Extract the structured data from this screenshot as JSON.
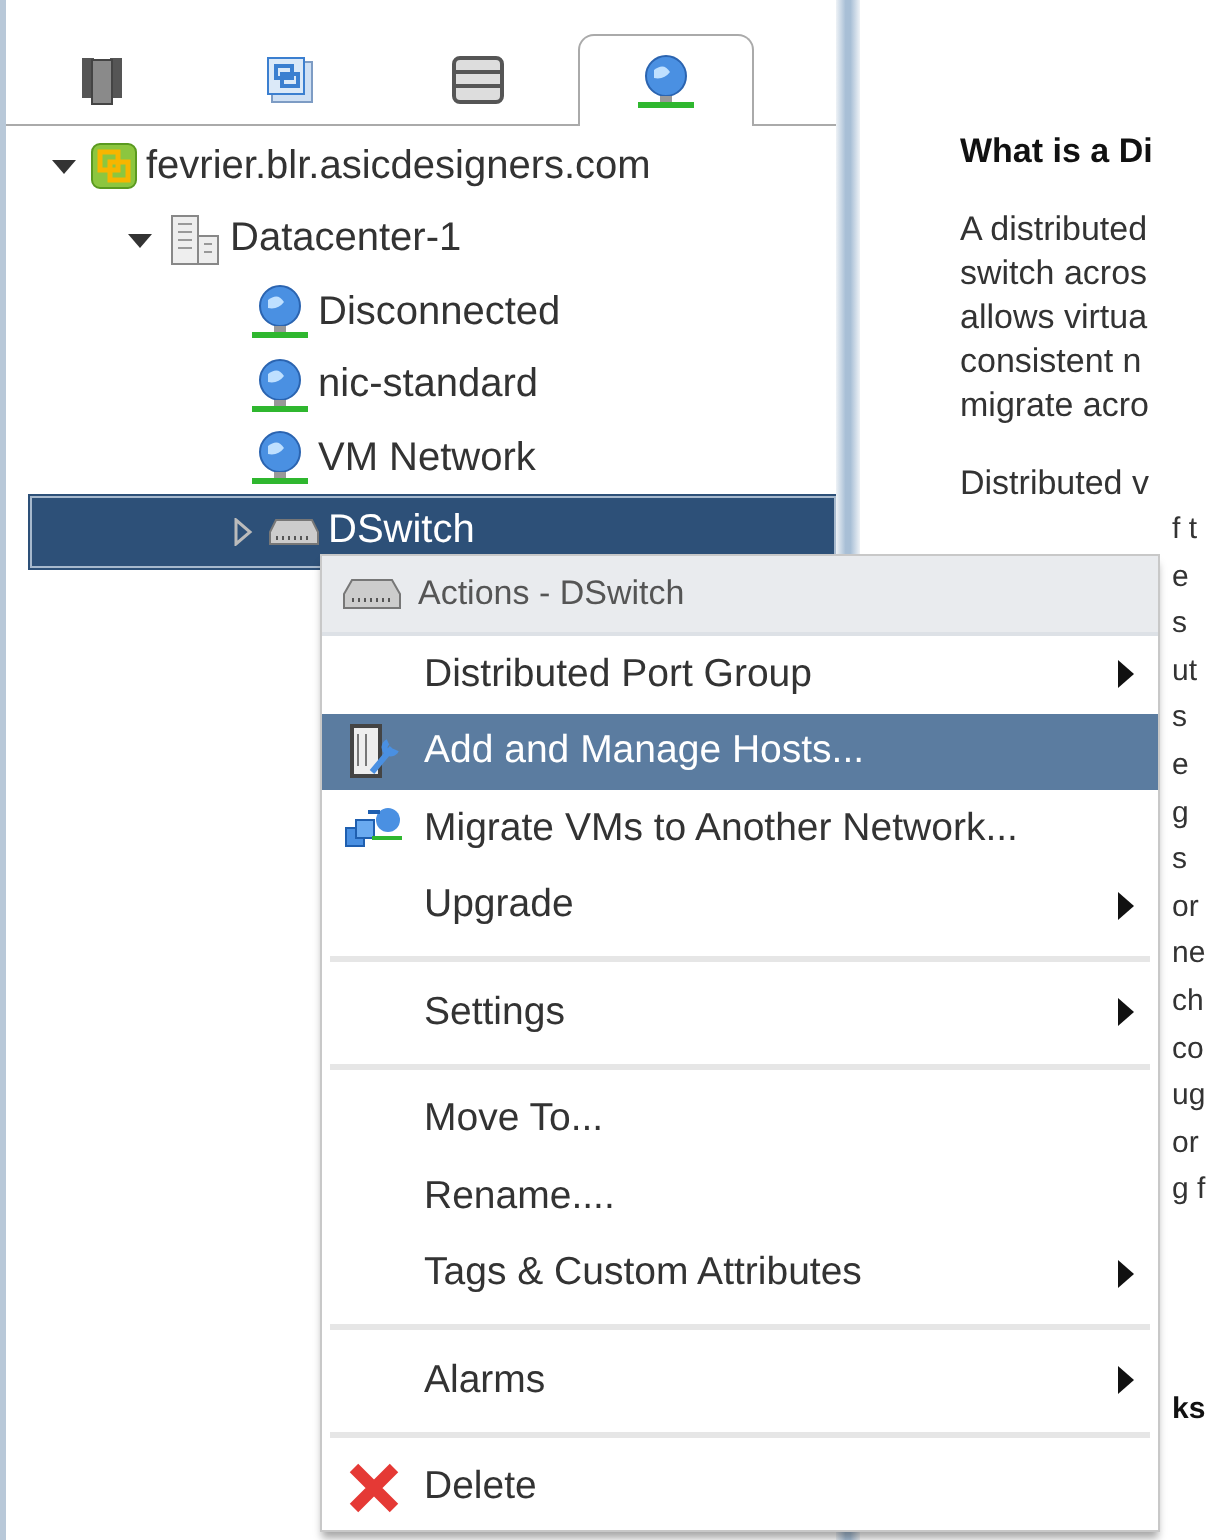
{
  "tabs": [
    {
      "kind": "hosts",
      "selected": false
    },
    {
      "kind": "vms",
      "selected": false
    },
    {
      "kind": "storage",
      "selected": false
    },
    {
      "kind": "networking",
      "selected": true
    }
  ],
  "tree": [
    {
      "label": "fevrier.blr.asicdesigners.com",
      "kind": "vcenter",
      "expanded": true,
      "selected": false,
      "children": [
        {
          "label": "Datacenter-1",
          "kind": "datacenter",
          "expanded": true,
          "selected": false,
          "children": [
            {
              "label": "Disconnected",
              "kind": "network",
              "selected": false
            },
            {
              "label": "nic-standard",
              "kind": "network",
              "selected": false
            },
            {
              "label": "VM Network",
              "kind": "network",
              "selected": false
            },
            {
              "label": "DSwitch",
              "kind": "dswitch",
              "expanded": false,
              "selected": true
            }
          ]
        }
      ]
    }
  ],
  "info": {
    "heading": "What is a Di",
    "lines": [
      "A distributed",
      "switch acros",
      "allows virtua",
      "consistent n",
      "migrate acro"
    ],
    "second_line": "Distributed v",
    "fragments": [
      "f t",
      "e",
      "s",
      "ut",
      "s",
      "e",
      "g",
      "s",
      "or",
      "ne",
      "ch",
      "co",
      "ug",
      "or",
      "g f"
    ],
    "bottom_heading": "ks"
  },
  "context_menu": {
    "title": "Actions - DSwitch",
    "groups": [
      [
        {
          "label": "Distributed Port Group",
          "kind": "none",
          "submenu": true,
          "selected": false
        },
        {
          "label": "Add and Manage Hosts...",
          "kind": "hosts",
          "submenu": false,
          "selected": true
        },
        {
          "label": "Migrate VMs to Another Network...",
          "kind": "migrate",
          "submenu": false,
          "selected": false
        },
        {
          "label": "Upgrade",
          "kind": "none",
          "submenu": true,
          "selected": false
        }
      ],
      [
        {
          "label": "Settings",
          "kind": "none",
          "submenu": true,
          "selected": false
        }
      ],
      [
        {
          "label": "Move To...",
          "kind": "none",
          "submenu": false,
          "selected": false
        },
        {
          "label": "Rename....",
          "kind": "none",
          "submenu": false,
          "selected": false
        },
        {
          "label": "Tags & Custom Attributes",
          "kind": "none",
          "submenu": true,
          "selected": false
        }
      ],
      [
        {
          "label": "Alarms",
          "kind": "none",
          "submenu": true,
          "selected": false
        }
      ],
      [
        {
          "label": "Delete",
          "kind": "delete",
          "submenu": false,
          "selected": false
        }
      ]
    ]
  }
}
